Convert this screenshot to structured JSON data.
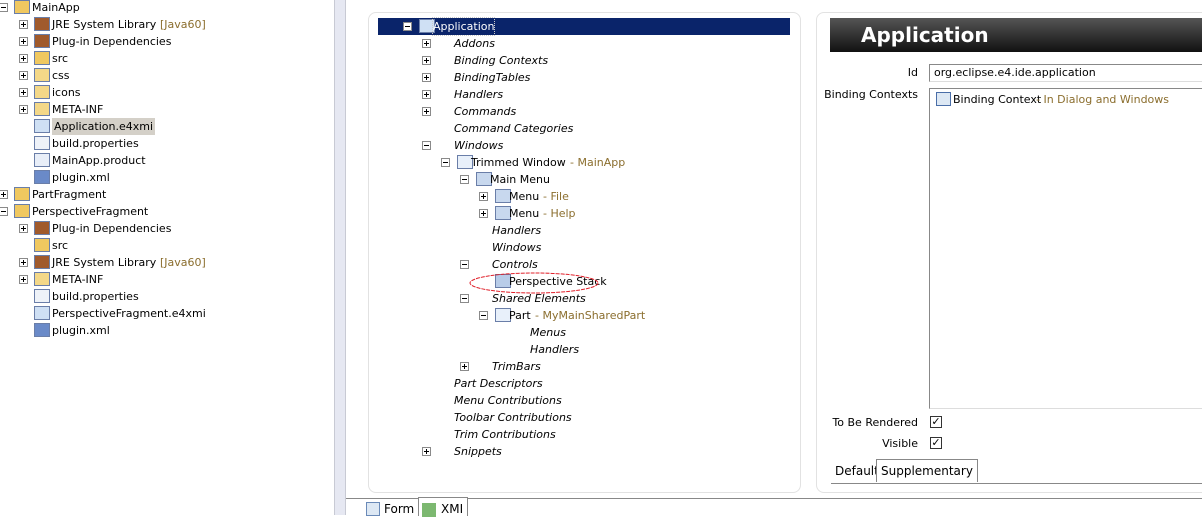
{
  "package_explorer": {
    "rows": [
      {
        "depth": 0,
        "expander": "minus",
        "icon": "project-folder-warning-icon",
        "label": "MainApp"
      },
      {
        "depth": 1,
        "expander": "plus",
        "icon": "library-icon",
        "label": "JRE System Library",
        "decoration": "[Java60]"
      },
      {
        "depth": 1,
        "expander": "plus",
        "icon": "library-icon",
        "label": "Plug-in Dependencies"
      },
      {
        "depth": 1,
        "expander": "plus",
        "icon": "source-folder-warning-icon",
        "label": "src"
      },
      {
        "depth": 1,
        "expander": "plus",
        "icon": "folder-icon",
        "label": "css"
      },
      {
        "depth": 1,
        "expander": "plus",
        "icon": "folder-icon",
        "label": "icons"
      },
      {
        "depth": 1,
        "expander": "plus",
        "icon": "folder-icon",
        "label": "META-INF"
      },
      {
        "depth": 1,
        "expander": "none",
        "icon": "e4xmi-file-icon",
        "label": "Application.e4xmi",
        "selected": true
      },
      {
        "depth": 1,
        "expander": "none",
        "icon": "properties-file-icon",
        "label": "build.properties"
      },
      {
        "depth": 1,
        "expander": "none",
        "icon": "product-file-icon",
        "label": "MainApp.product"
      },
      {
        "depth": 1,
        "expander": "none",
        "icon": "plugin-xml-icon",
        "label": "plugin.xml"
      },
      {
        "depth": 0,
        "expander": "plus",
        "icon": "project-folder-icon",
        "label": "PartFragment"
      },
      {
        "depth": 0,
        "expander": "minus",
        "icon": "project-folder-icon",
        "label": "PerspectiveFragment"
      },
      {
        "depth": 1,
        "expander": "plus",
        "icon": "library-icon",
        "label": "Plug-in Dependencies"
      },
      {
        "depth": 1,
        "expander": "none",
        "icon": "source-folder-icon",
        "label": "src"
      },
      {
        "depth": 1,
        "expander": "plus",
        "icon": "library-icon",
        "label": "JRE System Library",
        "decoration": "[Java60]"
      },
      {
        "depth": 1,
        "expander": "plus",
        "icon": "folder-icon",
        "label": "META-INF"
      },
      {
        "depth": 1,
        "expander": "none",
        "icon": "properties-file-icon",
        "label": "build.properties"
      },
      {
        "depth": 1,
        "expander": "none",
        "icon": "e4xmi-file-icon",
        "label": "PerspectiveFragment.e4xmi"
      },
      {
        "depth": 1,
        "expander": "none",
        "icon": "plugin-xml-icon",
        "label": "plugin.xml"
      }
    ]
  },
  "model_tree": {
    "rows": [
      {
        "depth": 0,
        "expander": "minus",
        "icon": "application-icon",
        "label": "Application",
        "selected": true
      },
      {
        "depth": 1,
        "expander": "plus",
        "label": "Addons",
        "italic": true
      },
      {
        "depth": 1,
        "expander": "plus",
        "label": "Binding Contexts",
        "italic": true
      },
      {
        "depth": 1,
        "expander": "plus",
        "label": "BindingTables",
        "italic": true
      },
      {
        "depth": 1,
        "expander": "plus",
        "label": "Handlers",
        "italic": true
      },
      {
        "depth": 1,
        "expander": "plus",
        "label": "Commands",
        "italic": true
      },
      {
        "depth": 1,
        "expander": "none",
        "label": "Command Categories",
        "italic": true
      },
      {
        "depth": 1,
        "expander": "minus",
        "label": "Windows",
        "italic": true
      },
      {
        "depth": 2,
        "expander": "minus",
        "icon": "window-icon",
        "label": "Trimmed Window",
        "decoration": "- MainApp"
      },
      {
        "depth": 3,
        "expander": "minus",
        "icon": "menu-icon",
        "label": "Main Menu"
      },
      {
        "depth": 4,
        "expander": "plus",
        "icon": "menu-icon",
        "label": "Menu",
        "decoration": "- File"
      },
      {
        "depth": 4,
        "expander": "plus",
        "icon": "menu-icon",
        "label": "Menu",
        "decoration": "- Help"
      },
      {
        "depth": 3,
        "expander": "none",
        "label": "Handlers",
        "italic": true
      },
      {
        "depth": 3,
        "expander": "none",
        "label": "Windows",
        "italic": true
      },
      {
        "depth": 3,
        "expander": "minus",
        "label": "Controls",
        "italic": true
      },
      {
        "depth": 4,
        "expander": "none",
        "icon": "perspective-stack-icon",
        "label": "Perspective Stack",
        "highlighted": true
      },
      {
        "depth": 3,
        "expander": "minus",
        "label": "Shared Elements",
        "italic": true
      },
      {
        "depth": 4,
        "expander": "minus",
        "icon": "window-icon",
        "label": "Part",
        "decoration": "- MyMainSharedPart"
      },
      {
        "depth": 5,
        "expander": "none",
        "label": "Menus",
        "italic": true
      },
      {
        "depth": 5,
        "expander": "none",
        "label": "Handlers",
        "italic": true
      },
      {
        "depth": 3,
        "expander": "plus",
        "label": "TrimBars",
        "italic": true
      },
      {
        "depth": 1,
        "expander": "none",
        "label": "Part Descriptors",
        "italic": true
      },
      {
        "depth": 1,
        "expander": "none",
        "label": "Menu Contributions",
        "italic": true
      },
      {
        "depth": 1,
        "expander": "none",
        "label": "Toolbar Contributions",
        "italic": true
      },
      {
        "depth": 1,
        "expander": "none",
        "label": "Trim Contributions",
        "italic": true
      },
      {
        "depth": 1,
        "expander": "plus",
        "label": "Snippets",
        "italic": true
      }
    ]
  },
  "details": {
    "title": "Application",
    "id_label": "Id",
    "id_value": "org.eclipse.e4.ide.application",
    "binding_contexts_label": "Binding Contexts",
    "binding_context_item": {
      "label": "Binding Context",
      "decoration": "- In Dialog and Windows"
    },
    "to_be_rendered_label": "To Be Rendered",
    "to_be_rendered": true,
    "visible_label": "Visible",
    "visible": true,
    "tabs": [
      "Default",
      "Supplementary"
    ],
    "active_tab": "Supplementary"
  },
  "editor_tabs": [
    "Form",
    "XMI"
  ],
  "colors": {
    "selection": "#0a246a",
    "decoration": "#8b6e2e",
    "highlight_ellipse": "#e0202a"
  }
}
